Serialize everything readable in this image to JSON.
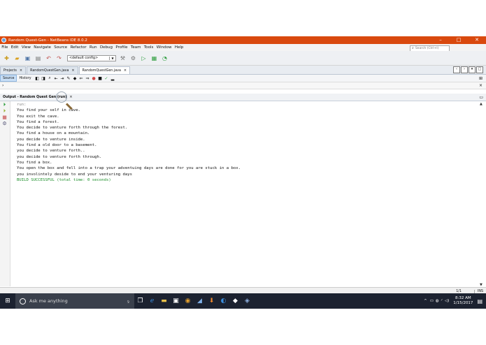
{
  "window": {
    "title": "Random Quest-Gen - NetBeans IDE 8.0.2",
    "controls": [
      "–",
      "□",
      "✕"
    ]
  },
  "menu": [
    "File",
    "Edit",
    "View",
    "Navigate",
    "Source",
    "Refactor",
    "Run",
    "Debug",
    "Profile",
    "Team",
    "Tools",
    "Window",
    "Help"
  ],
  "search": {
    "placeholder": "Search (Ctrl+I)"
  },
  "toolbar": {
    "config": "<default config>"
  },
  "tabs": [
    {
      "label": "Projects",
      "active": false
    },
    {
      "label": "RandomQuestGen.java",
      "active": false
    },
    {
      "label": "RandomQuestGen.java",
      "active": true
    }
  ],
  "editor": {
    "source_label": "Source",
    "history_label": "History"
  },
  "output": {
    "title": "Output - Random Quest Gen (run)",
    "lines": [
      {
        "text": "run:",
        "kind": "run"
      },
      {
        "text": "You find your self in cave.",
        "kind": "normal"
      },
      {
        "text": "You exit the cave.",
        "kind": "normal"
      },
      {
        "text": "You find a forest.",
        "kind": "normal"
      },
      {
        "text": "You decide to venture forth through the forest.",
        "kind": "normal"
      },
      {
        "text": "You find a house on a mountain.",
        "kind": "normal"
      },
      {
        "text": "you decide to venture inside.",
        "kind": "normal"
      },
      {
        "text": "You find a old door to a basement.",
        "kind": "normal"
      },
      {
        "text": "you decide to venture forth..",
        "kind": "normal"
      },
      {
        "text": "you decide to venture forth through.",
        "kind": "normal"
      },
      {
        "text": "You find a box.",
        "kind": "normal"
      },
      {
        "text": "You open the box and fell into a trap your adventuing days are done for you are stuck in a box.",
        "kind": "normal"
      },
      {
        "text": "you involintely deside to end your venturing days",
        "kind": "normal"
      },
      {
        "text": "BUILD SUCCESSFUL (total time: 0 seconds)",
        "kind": "ok"
      }
    ]
  },
  "status": {
    "position": "1/1",
    "mode": "INS"
  },
  "taskbar": {
    "search_placeholder": "Ask me anything",
    "time": "8:32 AM",
    "date": "1/15/2017"
  }
}
